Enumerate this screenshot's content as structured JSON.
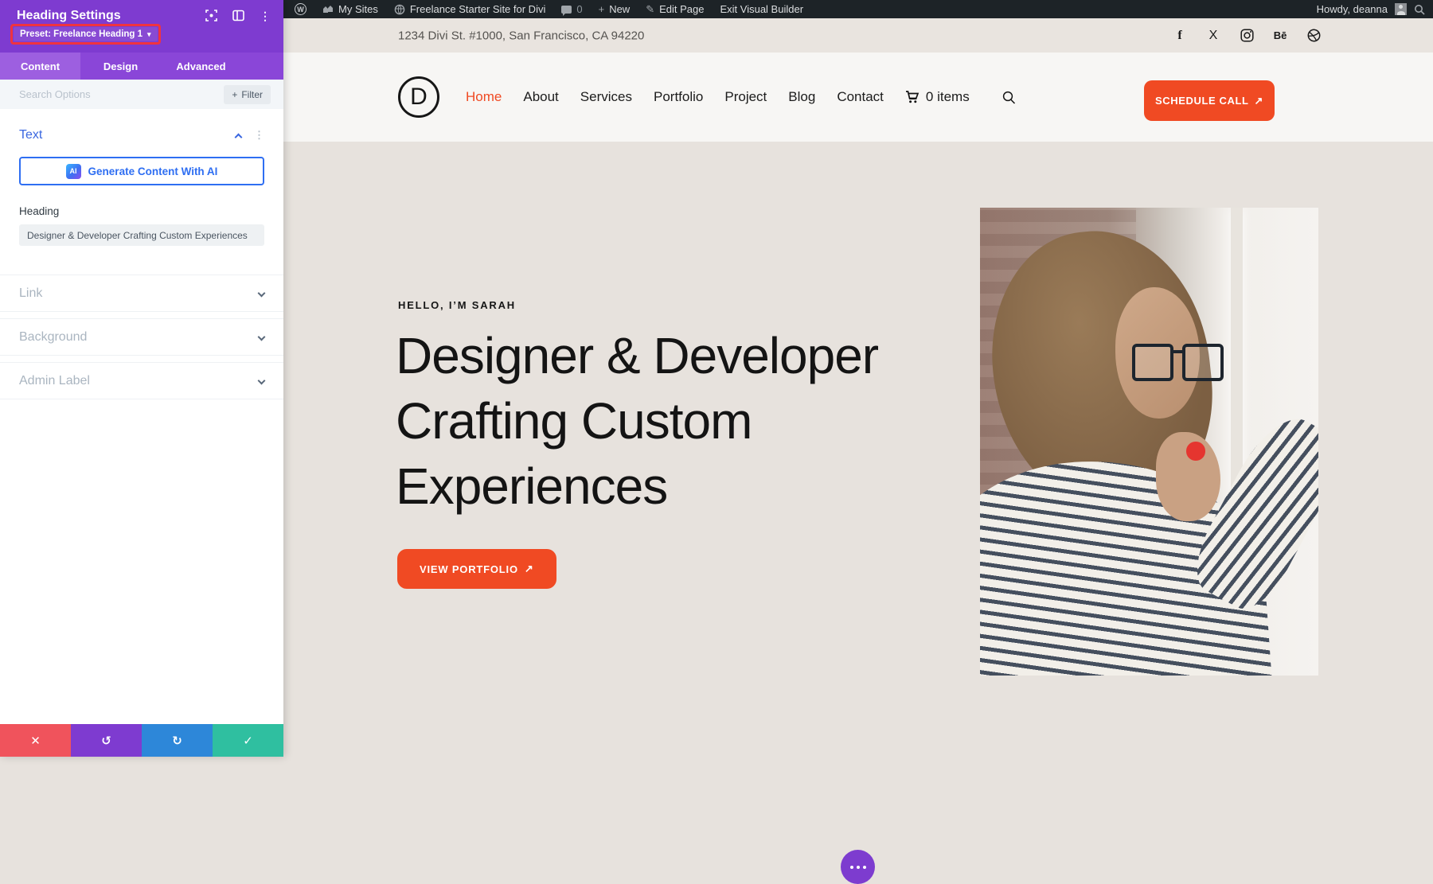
{
  "admin_bar": {
    "my_sites": "My Sites",
    "site_name": "Freelance Starter Site for Divi",
    "comment_count": "0",
    "new_label": "New",
    "edit_page": "Edit Page",
    "exit_builder": "Exit Visual Builder",
    "howdy": "Howdy, deanna"
  },
  "builder": {
    "title": "Heading Settings",
    "preset": "Preset: Freelance Heading 1",
    "tabs": [
      "Content",
      "Design",
      "Advanced"
    ],
    "search_placeholder": "Search Options",
    "filter_label": "Filter",
    "text_section": {
      "title": "Text",
      "ai_badge": "AI",
      "ai_button": "Generate Content With AI",
      "heading_label": "Heading",
      "heading_value": "Designer & Developer Crafting Custom Experiences"
    },
    "sections": [
      "Link",
      "Background",
      "Admin Label"
    ]
  },
  "site": {
    "topbar": {
      "address": "1234 Divi St. #1000, San Francisco, CA 94220"
    },
    "header": {
      "logo_letter": "D",
      "nav": [
        "Home",
        "About",
        "Services",
        "Portfolio",
        "Project",
        "Blog",
        "Contact"
      ],
      "cart_label": "0 items",
      "cta": "SCHEDULE CALL"
    },
    "hero": {
      "eyebrow": "HELLO, I’M SARAH",
      "heading": "Designer & Developer Crafting Custom Experiences",
      "cta": "VIEW PORTFOLIO"
    }
  },
  "icons": {
    "wp_w": "W",
    "plus": "+",
    "pencil": "✎",
    "caret_down": "▾",
    "kebab": "⋮",
    "arrow_up_right": "↗",
    "discard": "✕",
    "undo": "↺",
    "redo": "↻",
    "save": "✓",
    "facebook": "f",
    "x_logo": "X",
    "behance": "Bē"
  },
  "colors": {
    "accent_orange": "#F04A23",
    "builder_purple": "#7E3BD0",
    "highlight_red": "#F0333F",
    "ai_blue": "#2E6EF2",
    "admin_bar_bg": "#1D2327",
    "hero_beige": "#E7E2DD"
  }
}
